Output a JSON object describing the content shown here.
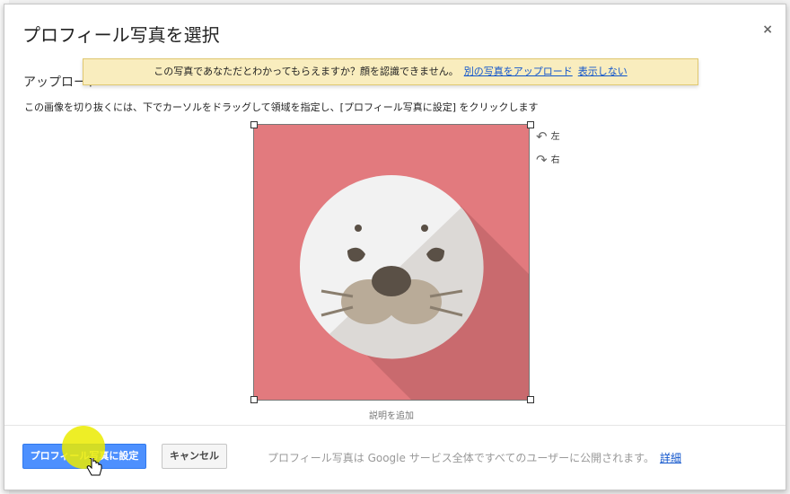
{
  "dialog": {
    "title": "プロフィール写真を選択",
    "close": "×",
    "upload_label": "アップロード"
  },
  "notice": {
    "message": "この写真であなただとわかってもらえますか？顔を認識できません。",
    "link_upload": "別の写真をアップロード",
    "link_hide": "表示しない"
  },
  "instruction": "この画像を切り抜くには、下でカーソルをドラッグして領域を指定し、[プロフィール写真に設定] をクリックします",
  "rotate": {
    "left": "左",
    "right": "右"
  },
  "caption": "説明を追加",
  "footer": {
    "set_button": "プロフィール写真に設定",
    "cancel_button": "キャンセル",
    "public_note": "プロフィール写真は Google サービス全体ですべてのユーザーに公開されます。",
    "details_link": "詳細"
  },
  "colors": {
    "photo_bg": "#e27a7e",
    "primary_button": "#4d90fe",
    "notice_bg": "#f9edbe",
    "link": "#1155cc"
  }
}
